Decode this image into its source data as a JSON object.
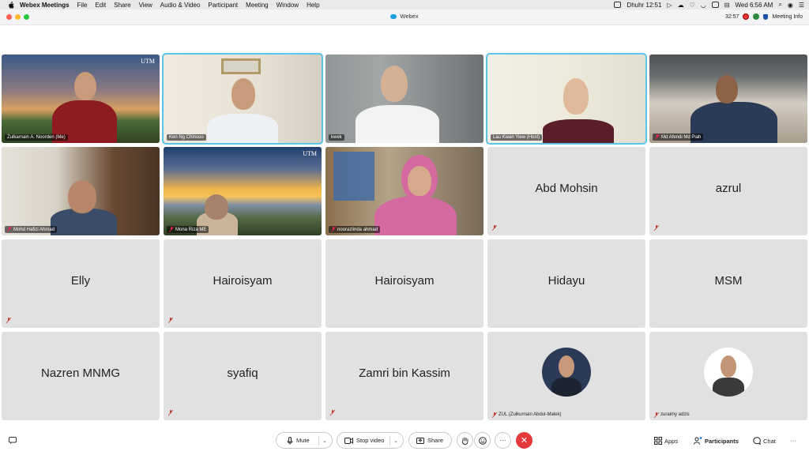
{
  "menubar": {
    "app_name": "Webex Meetings",
    "items": [
      "File",
      "Edit",
      "Share",
      "View",
      "Audio & Video",
      "Participant",
      "Meeting",
      "Window",
      "Help"
    ],
    "prayer": "Dhuhr 12:51",
    "datetime": "Wed 6:56 AM"
  },
  "window": {
    "title": "Webex",
    "timer": "32:57",
    "meeting_info": "Meeting Info"
  },
  "tiles": [
    {
      "name": "Zulkarnain A. Noorden  (Me)",
      "type": "video",
      "utm": true
    },
    {
      "name": "Ken Ng Chinsoo",
      "type": "video",
      "active": true
    },
    {
      "name": "kwek",
      "type": "video"
    },
    {
      "name": "Lau Kwan Yiew  (Host)",
      "type": "video",
      "active": true
    },
    {
      "name": "Md Afendi Md Piah",
      "type": "video"
    },
    {
      "name": "Mohd Hafizi Ahmad",
      "type": "video"
    },
    {
      "name": "Mona Riza ME",
      "type": "video",
      "utm": true
    },
    {
      "name": "noorazlinda ahmad",
      "type": "video"
    },
    {
      "name": "Abd Mohsin",
      "type": "name"
    },
    {
      "name": "azrul",
      "type": "name"
    },
    {
      "name": "Elly",
      "type": "name"
    },
    {
      "name": "Hairoisyam",
      "type": "name"
    },
    {
      "name": "Hairoisyam",
      "type": "name"
    },
    {
      "name": "Hidayu",
      "type": "name"
    },
    {
      "name": "MSM",
      "type": "name"
    },
    {
      "name": "Nazren MNMG",
      "type": "name"
    },
    {
      "name": "syafiq",
      "type": "name"
    },
    {
      "name": "Zamri bin Kassim",
      "type": "name"
    },
    {
      "name": "ZUL (Zulkurnain Abdul-Malek)",
      "type": "avatar"
    },
    {
      "name": "zuraimy adzis",
      "type": "avatar"
    }
  ],
  "utm_text": "UTM",
  "toolbar": {
    "mute": "Mute",
    "stop_video": "Stop video",
    "share": "Share",
    "more": "···",
    "apps": "Apps",
    "participants": "Participants",
    "chat": "Chat",
    "overflow": "···"
  },
  "colors": {
    "active_border": "#58c6ec",
    "end_call": "#e5383b",
    "tile_bg": "#e1e1e1",
    "mute_icon": "#c0392b"
  }
}
